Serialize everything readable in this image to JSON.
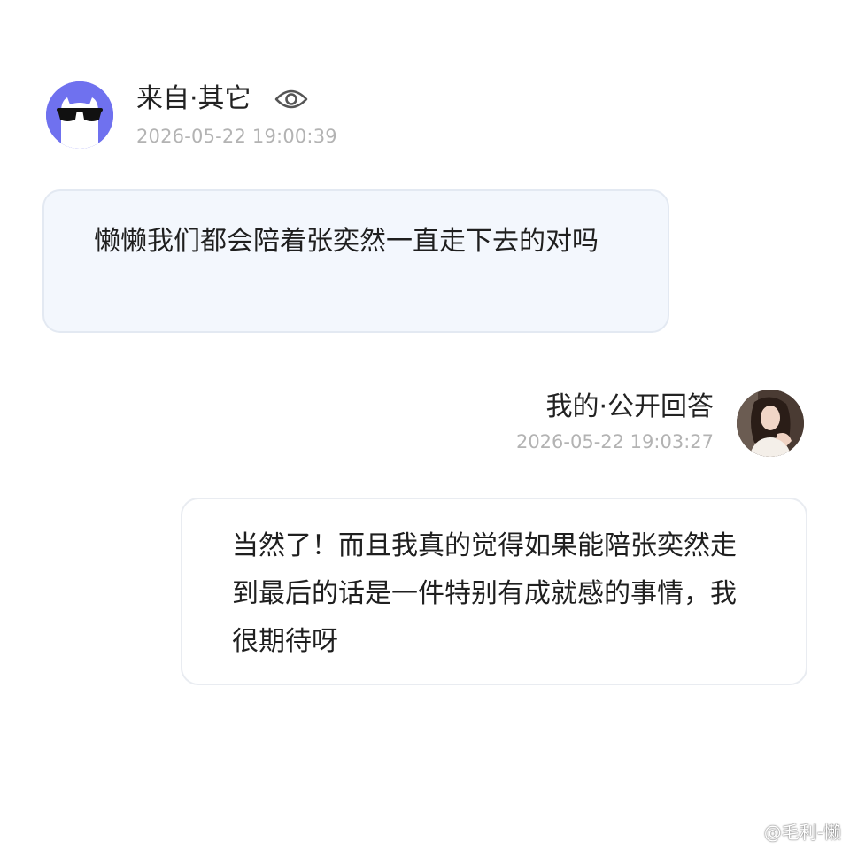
{
  "question": {
    "sender_label": "来自·其它",
    "visibility_icon": "eye-icon",
    "timestamp": "2026-05-22 19:00:39",
    "text": "懒懒我们都会陪着张奕然一直走下去的对吗",
    "avatar_icon": "cat-with-sunglasses-avatar",
    "colors": {
      "avatar_bg": "#6f71ef",
      "bubble_bg": "#f3f7fd"
    }
  },
  "answer": {
    "sender_label": "我的·公开回答",
    "timestamp": "2026-05-22 19:03:27",
    "text": "当然了！而且我真的觉得如果能陪张奕然走到最后的话是一件特别有成就感的事情，我很期待呀",
    "avatar_icon": "user-photo-avatar",
    "colors": {
      "bubble_bg": "#ffffff",
      "bubble_border": "#e9ecf1"
    }
  },
  "watermark": {
    "text": "@毛利-懒",
    "icon": "weibo-icon"
  }
}
